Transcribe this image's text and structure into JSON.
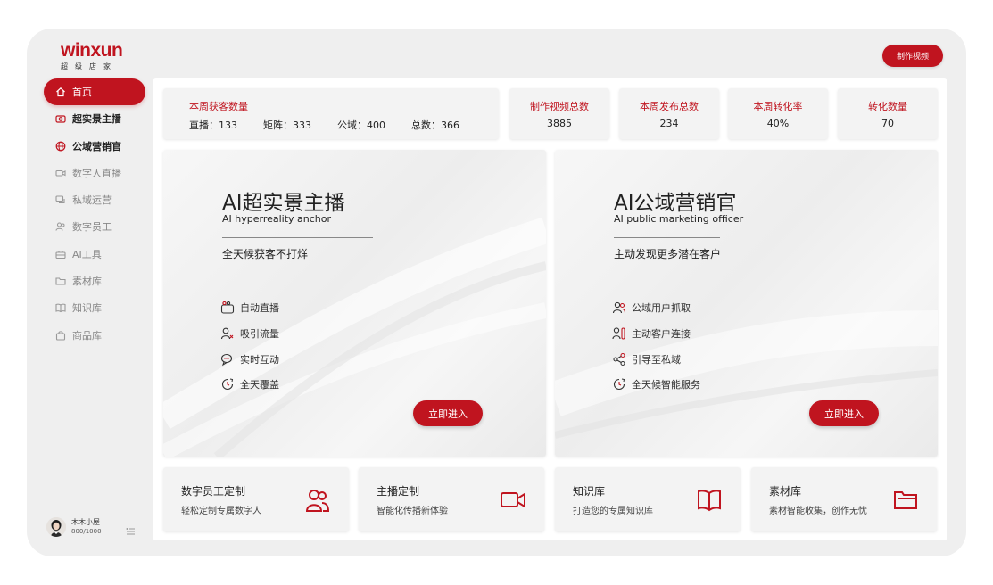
{
  "brand": {
    "logo": "winxun",
    "tagline": "超级店家"
  },
  "header": {
    "make_video_label": "制作视频"
  },
  "sidebar": {
    "items": [
      {
        "label": "首页",
        "icon": "home-icon"
      },
      {
        "label": "超实景主播",
        "icon": "camera-icon"
      },
      {
        "label": "公域营销官",
        "icon": "globe-icon"
      },
      {
        "label": "数字人直播",
        "icon": "video-icon"
      },
      {
        "label": "私域运营",
        "icon": "chat-icon"
      },
      {
        "label": "数字员工",
        "icon": "users-icon"
      },
      {
        "label": "AI工具",
        "icon": "toolbox-icon"
      },
      {
        "label": "素材库",
        "icon": "folder-icon"
      },
      {
        "label": "知识库",
        "icon": "book-icon"
      },
      {
        "label": "商品库",
        "icon": "bag-icon"
      }
    ]
  },
  "user": {
    "name": "木木小屋",
    "quota": "800/1000"
  },
  "stats": {
    "weekly_customers": {
      "title": "本周获客数量",
      "live_label": "直播：133",
      "matrix_label": "矩阵：333",
      "public_label": "公域：400",
      "total_label": "总数：366"
    },
    "cards": [
      {
        "title": "制作视频总数",
        "value": "3885"
      },
      {
        "title": "本周发布总数",
        "value": "234"
      },
      {
        "title": "本周转化率",
        "value": "40%"
      },
      {
        "title": "转化数量",
        "value": "70"
      }
    ]
  },
  "features": [
    {
      "title": "AI超实景主播",
      "subtitle": "AI hyperreality anchor",
      "desc": "全天候获客不打烊",
      "items": [
        {
          "label": "自动直播",
          "icon": "live-camera-icon"
        },
        {
          "label": "吸引流量",
          "icon": "user-traffic-icon"
        },
        {
          "label": "实时互动",
          "icon": "chat-bubbles-icon"
        },
        {
          "label": "全天覆盖",
          "icon": "clock-24-icon"
        }
      ],
      "button": "立即进入"
    },
    {
      "title": "AI公域营销官",
      "subtitle": "AI public marketing officer",
      "desc": "主动发现更多潜在客户",
      "items": [
        {
          "label": "公域用户抓取",
          "icon": "users-icon"
        },
        {
          "label": "主动客户连接",
          "icon": "user-connect-icon"
        },
        {
          "label": "引导至私域",
          "icon": "share-icon"
        },
        {
          "label": "全天候智能服务",
          "icon": "clock-24-icon"
        }
      ],
      "button": "立即进入"
    }
  ],
  "shortcuts": [
    {
      "title": "数字员工定制",
      "desc": "轻松定制专属数字人",
      "icon": "users-icon"
    },
    {
      "title": "主播定制",
      "desc": "智能化传播新体验",
      "icon": "video-camera-icon"
    },
    {
      "title": "知识库",
      "desc": "打造您的专属知识库",
      "icon": "book-icon"
    },
    {
      "title": "素材库",
      "desc": "素材智能收集，创作无忧",
      "icon": "folder-icon"
    }
  ],
  "colors": {
    "accent": "#c0141f",
    "background": "#efefef",
    "card": "#f3f3f3"
  }
}
